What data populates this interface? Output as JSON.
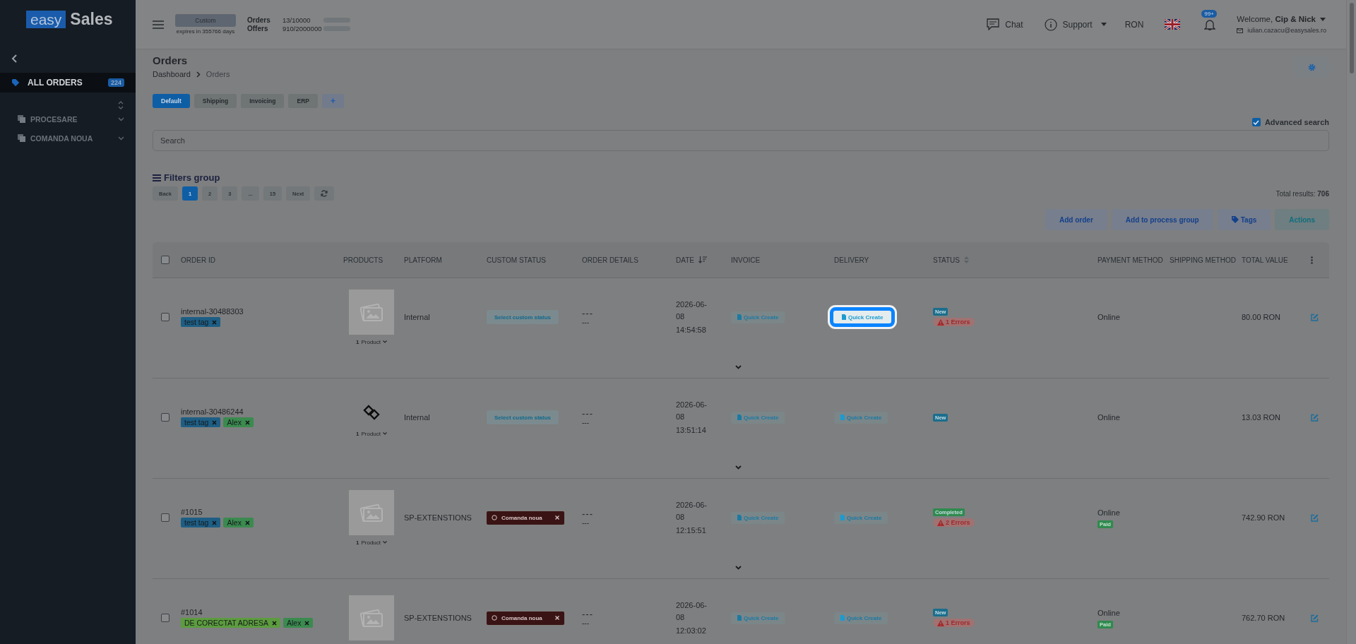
{
  "sidebar": {
    "logo": {
      "part1": "easy",
      "part2": "Sales"
    },
    "groups": [
      {
        "label": "ALL ORDERS",
        "count": "224",
        "selected": true
      }
    ],
    "folders": [
      {
        "label": "PROCESARE"
      },
      {
        "label": "COMANDA NOUA"
      }
    ]
  },
  "header": {
    "plan": {
      "name": "Custom",
      "expiry": "expires in 355766 days"
    },
    "usage": [
      {
        "label": "Orders",
        "value": "13/10000",
        "level": 0.0013
      },
      {
        "label": "Offers",
        "value": "910/2000000",
        "level": 0.0005
      }
    ],
    "chat": "Chat",
    "support": "Support",
    "currency": "RON",
    "notifications": "99+",
    "user": {
      "greeting": "Welcome, **Cip & Nick**",
      "email": "iulian.cazacu@easysales.ro"
    }
  },
  "page": {
    "title": "Orders",
    "breadcrumb": [
      "Dashboard",
      "Orders"
    ],
    "view_tabs": [
      {
        "label": "Default",
        "selected": true
      },
      {
        "label": "Shipping",
        "selected": false
      },
      {
        "label": "Invoicing",
        "selected": false
      },
      {
        "label": "ERP",
        "selected": false
      }
    ],
    "add_tab": "+",
    "advanced_search": {
      "label": "Advanced search",
      "checked": true
    },
    "search": {
      "placeholder": "Search"
    },
    "filters_title": "Filters group",
    "pagination": [
      {
        "label": "Back",
        "selected": false
      },
      {
        "label": "1",
        "selected": true
      },
      {
        "label": "2",
        "selected": false
      },
      {
        "label": "3",
        "selected": false
      },
      {
        "label": "...",
        "selected": false
      },
      {
        "label": "15",
        "selected": false
      },
      {
        "label": "Next",
        "selected": false
      }
    ],
    "total_results": "Total results: **706**",
    "actions": [
      {
        "label": "Add order",
        "kind": "plain"
      },
      {
        "label": "Add to process group",
        "kind": "plain"
      },
      {
        "label": "Tags",
        "kind": "tag"
      },
      {
        "label": "Actions",
        "kind": "accent"
      }
    ]
  },
  "table": {
    "select_all": {
      "checked": false
    },
    "columns": [
      {
        "label": "ORDER ID"
      },
      {
        "label": "PRODUCTS"
      },
      {
        "label": "PLATFORM"
      },
      {
        "label": "CUSTOM STATUS"
      },
      {
        "label": "ORDER DETAILS"
      },
      {
        "label": "DATE",
        "kind": "sort-desc"
      },
      {
        "label": "INVOICE"
      },
      {
        "label": "DELIVERY"
      },
      {
        "label": "STATUS",
        "kind": "sort-both"
      },
      {
        "label": "PAYMENT METHOD"
      },
      {
        "label": "SHIPPING METHOD"
      },
      {
        "label": "TOTAL VALUE"
      }
    ],
    "rows": [
      {
        "checked": false,
        "order_id": "internal-30488303",
        "tags": [
          {
            "label": "test tag",
            "color": "#1e5e85"
          }
        ],
        "product": {
          "kind": "placeholder",
          "count": "1",
          "label": "Product"
        },
        "platform": "Internal",
        "custom_status": {
          "kind": "select",
          "label": "Select custom status"
        },
        "details": [
          "---",
          "---"
        ],
        "date": "2026-06-08",
        "time": "14:54:58",
        "invoice": {
          "label": "Quick Create"
        },
        "delivery": {
          "label": "Quick Create",
          "highlighted": true
        },
        "statuses": [
          {
            "label": "New",
            "color": "#1b6e8d"
          }
        ],
        "errors": "1 Errors",
        "payment": {
          "method": "Online"
        },
        "total": "80.00 RON",
        "expandable": true
      },
      {
        "checked": false,
        "order_id": "internal-30486244",
        "tags": [
          {
            "label": "test tag",
            "color": "#1e5e85"
          },
          {
            "label": "Alex",
            "color": "#3b8a4f"
          }
        ],
        "product": {
          "kind": "logo",
          "count": "1",
          "label": "Product"
        },
        "platform": "Internal",
        "custom_status": {
          "kind": "select",
          "label": "Select custom status"
        },
        "details": [
          "---",
          "---"
        ],
        "date": "2026-06-08",
        "time": "13:51:14",
        "invoice": {
          "label": "Quick Create"
        },
        "delivery": {
          "label": "Quick Create",
          "highlighted": false
        },
        "statuses": [
          {
            "label": "New",
            "color": "#1b6e8d"
          }
        ],
        "payment": {
          "method": "Online"
        },
        "total": "13.03 RON",
        "expandable": true
      },
      {
        "checked": false,
        "order_id": "#1015",
        "tags": [
          {
            "label": "test tag",
            "color": "#1e5e85"
          },
          {
            "label": "Alex",
            "color": "#3b8a4f"
          }
        ],
        "product": {
          "kind": "placeholder",
          "count": "1",
          "label": "Product"
        },
        "platform": "SP-EXTENSTIONS",
        "custom_status": {
          "kind": "tag",
          "label": "Comanda noua"
        },
        "details": [
          "---",
          "---"
        ],
        "date": "2026-06-08",
        "time": "12:15:51",
        "invoice": {
          "label": "Quick Create"
        },
        "delivery": {
          "label": "Quick Create",
          "highlighted": false
        },
        "statuses": [
          {
            "label": "Completed",
            "color": "#2f8a4e"
          }
        ],
        "errors": "2 Errors",
        "payment": {
          "method": "Online",
          "paid_label": "Paid"
        },
        "total": "742.90 RON",
        "expandable": true
      },
      {
        "checked": false,
        "order_id": "#1014",
        "tags": [
          {
            "label": "DE CORECTAT ADRESA",
            "color": "#5c9c3e"
          },
          {
            "label": "Alex",
            "color": "#3b8a4f"
          }
        ],
        "product": {
          "kind": "placeholder"
        },
        "platform": "SP-EXTENSTIONS",
        "custom_status": {
          "kind": "tag",
          "label": "Comanda noua"
        },
        "details": [
          "---",
          "---"
        ],
        "date": "2026-06-08",
        "time": "12:03:02",
        "invoice": {
          "label": "Quick Create"
        },
        "delivery": {
          "label": "Quick Create",
          "highlighted": false
        },
        "statuses": [
          {
            "label": "New",
            "color": "#1b6e8d"
          }
        ],
        "errors": "1 Errors",
        "payment": {
          "method": "Online",
          "paid_label": "Paid"
        },
        "total": "762.70 RON",
        "expandable": false
      }
    ]
  }
}
